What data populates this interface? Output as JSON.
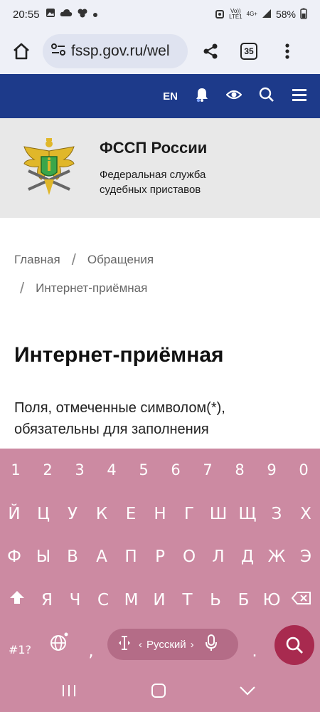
{
  "status_bar": {
    "time": "20:55",
    "network_top": "Vo))",
    "network_bottom": "LTE1",
    "signal_type": "4G+",
    "battery": "58%"
  },
  "browser": {
    "url": "fssp.gov.ru/wel",
    "tab_count": "35"
  },
  "site_header": {
    "lang": "EN"
  },
  "brand": {
    "name": "ФССП России",
    "subtitle": "Федеральная служба судебных приставов"
  },
  "breadcrumb": {
    "items": [
      "Главная",
      "Обращения",
      "Интернет-приёмная"
    ],
    "separator": "/"
  },
  "page": {
    "title": "Интернет-приёмная",
    "description": "Поля, отмеченные символом(*), обязательны для заполнения"
  },
  "keyboard": {
    "row_numbers": [
      "1",
      "2",
      "3",
      "4",
      "5",
      "6",
      "7",
      "8",
      "9",
      "0"
    ],
    "row_1": [
      "Й",
      "Ц",
      "У",
      "К",
      "Е",
      "Н",
      "Г",
      "Ш",
      "Щ",
      "З",
      "Х"
    ],
    "row_2": [
      "Ф",
      "Ы",
      "В",
      "А",
      "П",
      "Р",
      "О",
      "Л",
      "Д",
      "Ж",
      "Э"
    ],
    "row_3": [
      "Я",
      "Ч",
      "С",
      "М",
      "И",
      "Т",
      "Ь",
      "Б",
      "Ю"
    ],
    "symbols_key": "#1?",
    "comma_key": ",",
    "period_key": ".",
    "space_lang_label": "Русский"
  },
  "colors": {
    "header_blue": "#1d3a8a",
    "keyboard_bg": "#cc8aa2",
    "enter_bg": "#a82a4f"
  }
}
